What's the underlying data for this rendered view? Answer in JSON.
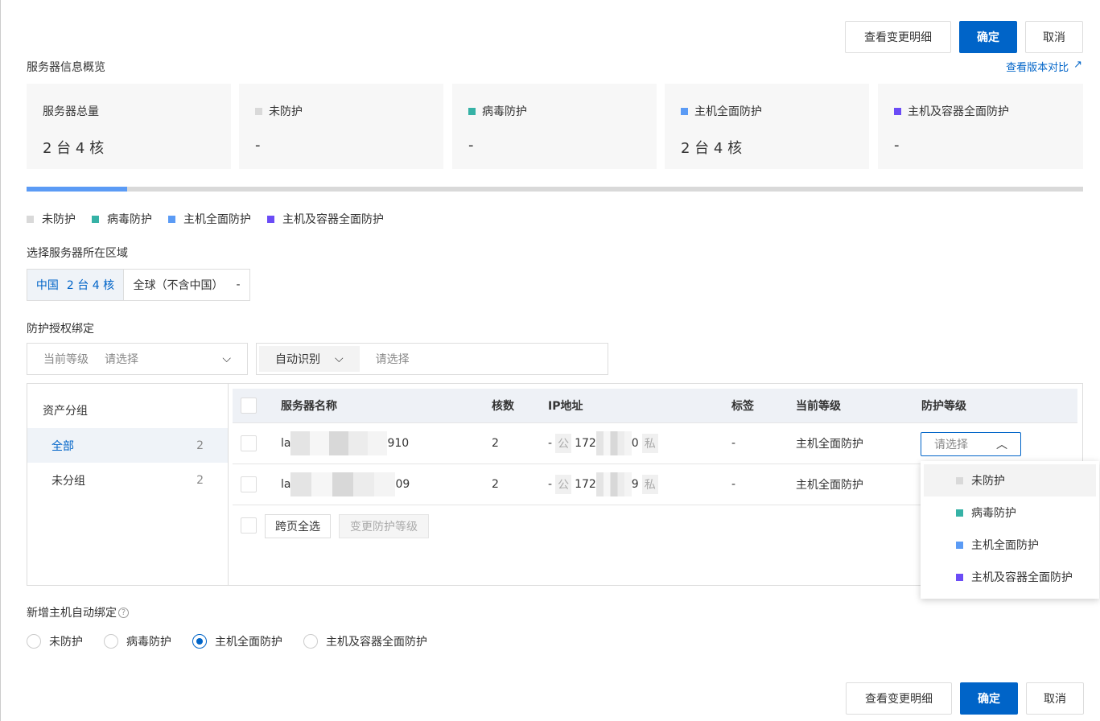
{
  "top_buttons": {
    "details": "查看变更明细",
    "confirm": "确定",
    "cancel": "取消"
  },
  "overview": {
    "title": "服务器信息概览",
    "compare_link": "查看版本对比",
    "cards": [
      {
        "label": "服务器总量",
        "value": "2 台 4 核"
      },
      {
        "label": "未防护",
        "value": "-",
        "color": "#d9d9d9"
      },
      {
        "label": "病毒防护",
        "value": "-",
        "color": "#36b2a6"
      },
      {
        "label": "主机全面防护",
        "value": "2 台 4 核",
        "color": "#5b9bf5"
      },
      {
        "label": "主机及容器全面防护",
        "value": "-",
        "color": "#6b4cf6"
      }
    ],
    "progress_fraction": 0.095
  },
  "legend": [
    {
      "label": "未防护",
      "color": "#d9d9d9"
    },
    {
      "label": "病毒防护",
      "color": "#36b2a6"
    },
    {
      "label": "主机全面防护",
      "color": "#5b9bf5"
    },
    {
      "label": "主机及容器全面防护",
      "color": "#6b4cf6"
    }
  ],
  "region": {
    "title": "选择服务器所在区域",
    "tabs": [
      {
        "label": "中国",
        "value": "2 台 4 核"
      },
      {
        "label": "全球（不含中国）",
        "value": "-"
      }
    ]
  },
  "binding": {
    "title": "防护授权绑定",
    "current_level_label": "当前等级",
    "current_level_placeholder": "请选择",
    "auto_label": "自动识别",
    "auto_placeholder": "请选择"
  },
  "groups": {
    "title": "资产分组",
    "items": [
      {
        "label": "全部",
        "count": "2"
      },
      {
        "label": "未分组",
        "count": "2"
      }
    ]
  },
  "table": {
    "headers": [
      "服务器名称",
      "核数",
      "IP地址",
      "标签",
      "当前等级",
      "防护等级"
    ],
    "rows": [
      {
        "name_prefix": "la",
        "name_suffix": "910",
        "cores": "2",
        "ip_dash": "-",
        "pub": "公",
        "ip_prefix": "172",
        "ip_suffix": "0",
        "priv": "私",
        "tag": "-",
        "level": "主机全面防护"
      },
      {
        "name_prefix": "la",
        "name_suffix": "09",
        "cores": "2",
        "ip_dash": "-",
        "pub": "公",
        "ip_prefix": "172",
        "ip_suffix": "9",
        "priv": "私",
        "tag": "-",
        "level": "主机全面防护"
      }
    ],
    "select_placeholder": "请选择",
    "select_all_pages": "跨页全选",
    "change_level": "变更防护等级"
  },
  "dropdown": [
    "未防护",
    "病毒防护",
    "主机全面防护",
    "主机及容器全面防护"
  ],
  "auto_bind": {
    "title": "新增主机自动绑定",
    "options": [
      "未防护",
      "病毒防护",
      "主机全面防护",
      "主机及容器全面防护"
    ],
    "selected": 2
  },
  "bottom_buttons": {
    "details": "查看变更明细",
    "confirm": "确定",
    "cancel": "取消"
  }
}
